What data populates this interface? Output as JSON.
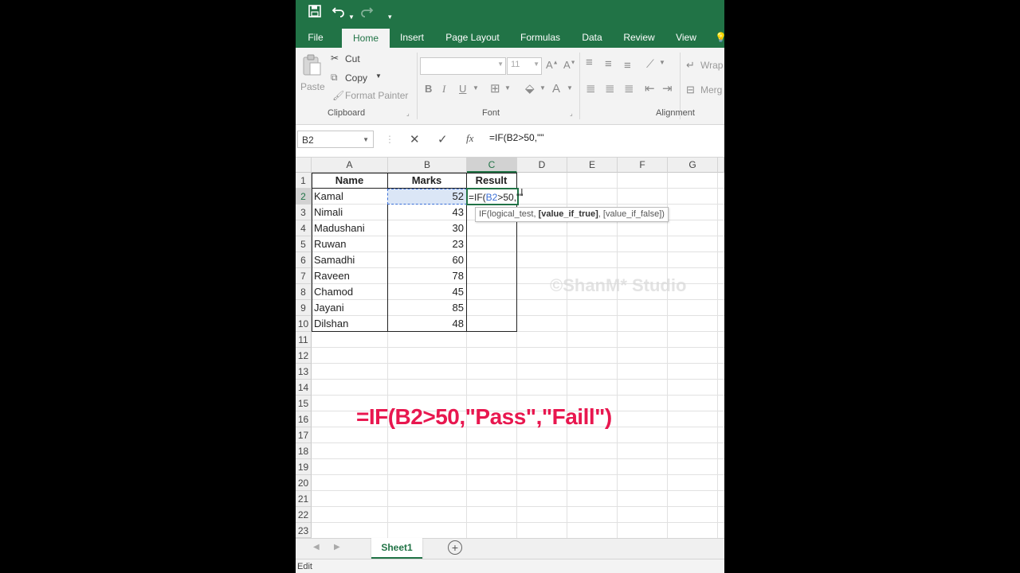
{
  "quick_access": {
    "save_icon": "save-icon",
    "undo_icon": "undo-icon",
    "redo_icon": "redo-icon",
    "customize_icon": "customize-icon"
  },
  "tabs": [
    "File",
    "Home",
    "Insert",
    "Page Layout",
    "Formulas",
    "Data",
    "Review",
    "View"
  ],
  "active_tab": "Home",
  "ribbon": {
    "clipboard": {
      "paste": "Paste",
      "cut": "Cut",
      "copy": "Copy",
      "format_painter": "Format Painter",
      "label": "Clipboard"
    },
    "font": {
      "font_name": "",
      "font_size": "11",
      "bold": "B",
      "italic": "I",
      "underline": "U",
      "label": "Font"
    },
    "alignment": {
      "wrap": "Wrap",
      "merge": "Merg",
      "label": "Alignment"
    }
  },
  "formula_bar": {
    "name_box": "B2",
    "cancel": "✕",
    "enter": "✓",
    "fx": "fx",
    "formula": "=IF(B2>50,\"\""
  },
  "columns": [
    "A",
    "B",
    "C",
    "D",
    "E",
    "F",
    "G"
  ],
  "rows": [
    "1",
    "2",
    "3",
    "4",
    "5",
    "6",
    "7",
    "8",
    "9",
    "10",
    "11",
    "12",
    "13",
    "14",
    "15",
    "16",
    "17",
    "18",
    "19",
    "20",
    "21",
    "22",
    "23"
  ],
  "table": {
    "headers": [
      "Name",
      "Marks",
      "Result"
    ],
    "data": [
      {
        "name": "Kamal",
        "marks": "52"
      },
      {
        "name": "Nimali",
        "marks": "43"
      },
      {
        "name": "Madushani",
        "marks": "30"
      },
      {
        "name": "Ruwan",
        "marks": "23"
      },
      {
        "name": "Samadhi",
        "marks": "60"
      },
      {
        "name": "Raveen",
        "marks": "78"
      },
      {
        "name": "Chamod",
        "marks": "45"
      },
      {
        "name": "Jayani",
        "marks": "85"
      },
      {
        "name": "Dilshan",
        "marks": "48"
      }
    ],
    "editing_cell": {
      "prefix": "=IF(",
      "ref": "B2",
      "suffix": ">50,\"\""
    }
  },
  "tooltip": {
    "prefix": "IF(logical_test, ",
    "bold": "[value_if_true]",
    "suffix": ", [value_if_false])"
  },
  "overlay_text": "=IF(B2>50,\"Pass\",\"Faill\")",
  "watermark": "©ShanM* Studio",
  "sheet_tab": "Sheet1",
  "status": "Edit",
  "colors": {
    "excel_green": "#217346",
    "overlay_pink": "#e8174f",
    "ref_blue": "#3b6fd6"
  }
}
